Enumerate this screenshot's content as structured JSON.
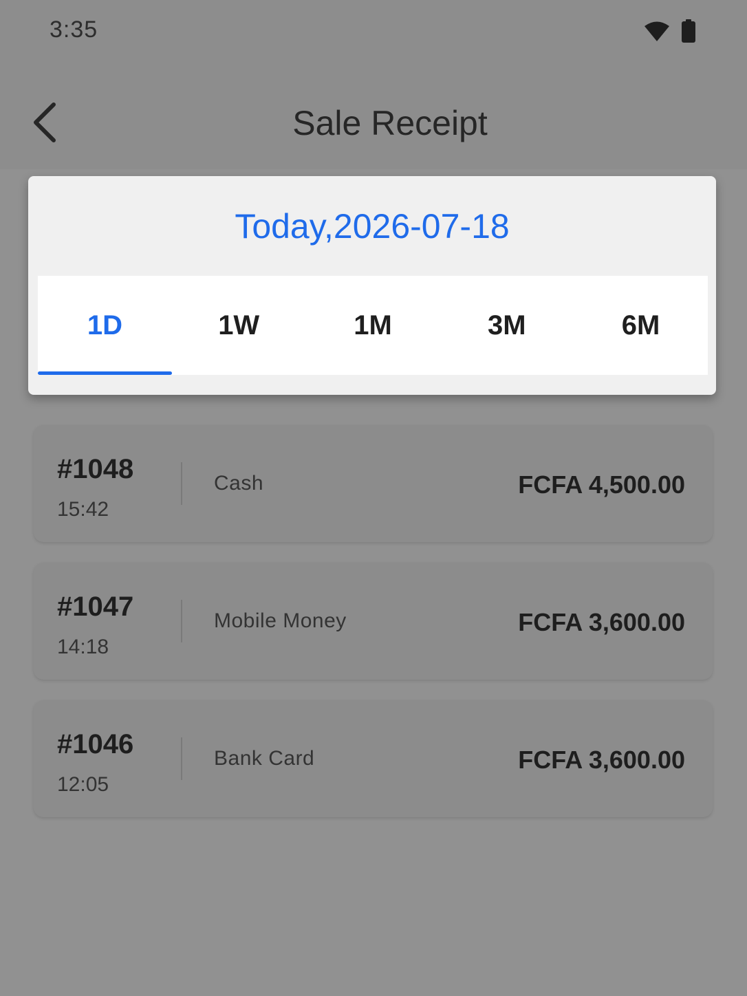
{
  "status_bar": {
    "time": "3:35",
    "icons": [
      "wifi-icon",
      "battery-icon"
    ]
  },
  "header": {
    "back_icon": "chevron-left-icon",
    "title": "Sale Receipt"
  },
  "date_picker": {
    "label": "Today,2026-07-18",
    "tabs": [
      {
        "label": "1D",
        "active": true
      },
      {
        "label": "1W",
        "active": false
      },
      {
        "label": "1M",
        "active": false
      },
      {
        "label": "3M",
        "active": false
      },
      {
        "label": "6M",
        "active": false
      }
    ]
  },
  "receipts": [
    {
      "number": "#1048",
      "time": "15:42",
      "method": "Cash",
      "amount": "FCFA 4,500.00"
    },
    {
      "number": "#1047",
      "time": "14:18",
      "method": "Mobile Money",
      "amount": "FCFA 3,600.00"
    },
    {
      "number": "#1046",
      "time": "12:05",
      "method": "Bank Card",
      "amount": "FCFA 3,600.00"
    }
  ],
  "colors": {
    "accent": "#1f6bea",
    "overlay_background": "#8f8f8f",
    "popup_background": "#f0f0f0"
  }
}
